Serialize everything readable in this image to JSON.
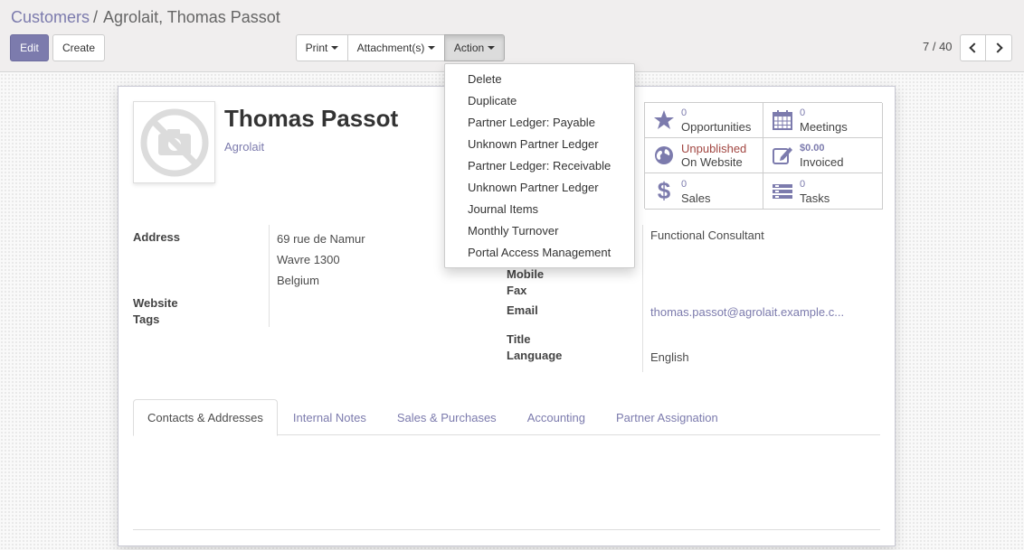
{
  "breadcrumb": {
    "parent": "Customers",
    "separator": "/",
    "current": "Agrolait, Thomas Passot"
  },
  "toolbar": {
    "edit_label": "Edit",
    "create_label": "Create",
    "print_label": "Print",
    "attachments_label": "Attachment(s)",
    "action_label": "Action"
  },
  "pager": {
    "value": "7 / 40"
  },
  "action_menu": {
    "items": [
      "Delete",
      "Duplicate",
      "Partner Ledger: Payable",
      "Unknown Partner Ledger",
      "Partner Ledger: Receivable",
      "Unknown Partner Ledger",
      "Journal Items",
      "Monthly Turnover",
      "Portal Access Management"
    ]
  },
  "partner": {
    "name": "Thomas Passot",
    "company": "Agrolait"
  },
  "stats": {
    "opportunities": {
      "value": "0",
      "label": "Opportunities"
    },
    "meetings": {
      "value": "0",
      "label": "Meetings"
    },
    "website": {
      "value": "Unpublished",
      "label": "On Website"
    },
    "invoiced": {
      "value": "$0.00",
      "label": "Invoiced"
    },
    "sales": {
      "value": "0",
      "label": "Sales"
    },
    "tasks": {
      "value": "0",
      "label": "Tasks"
    }
  },
  "fields": {
    "address_label": "Address",
    "address_lines": [
      "69 rue de Namur",
      "Wavre 1300",
      "Belgium"
    ],
    "website_label": "Website",
    "tags_label": "Tags",
    "job_position_value": "Functional Consultant",
    "mobile_label": "Mobile",
    "fax_label": "Fax",
    "email_label": "Email",
    "email_value": "thomas.passot@agrolait.example.c...",
    "title_label": "Title",
    "language_label": "Language",
    "language_value": "English"
  },
  "tabs": [
    {
      "label": "Contacts & Addresses",
      "active": true
    },
    {
      "label": "Internal Notes",
      "active": false
    },
    {
      "label": "Sales & Purchases",
      "active": false
    },
    {
      "label": "Accounting",
      "active": false
    },
    {
      "label": "Partner Assignation",
      "active": false
    }
  ],
  "colors": {
    "brand": "#7c7bad",
    "unpublished": "#a24742"
  }
}
